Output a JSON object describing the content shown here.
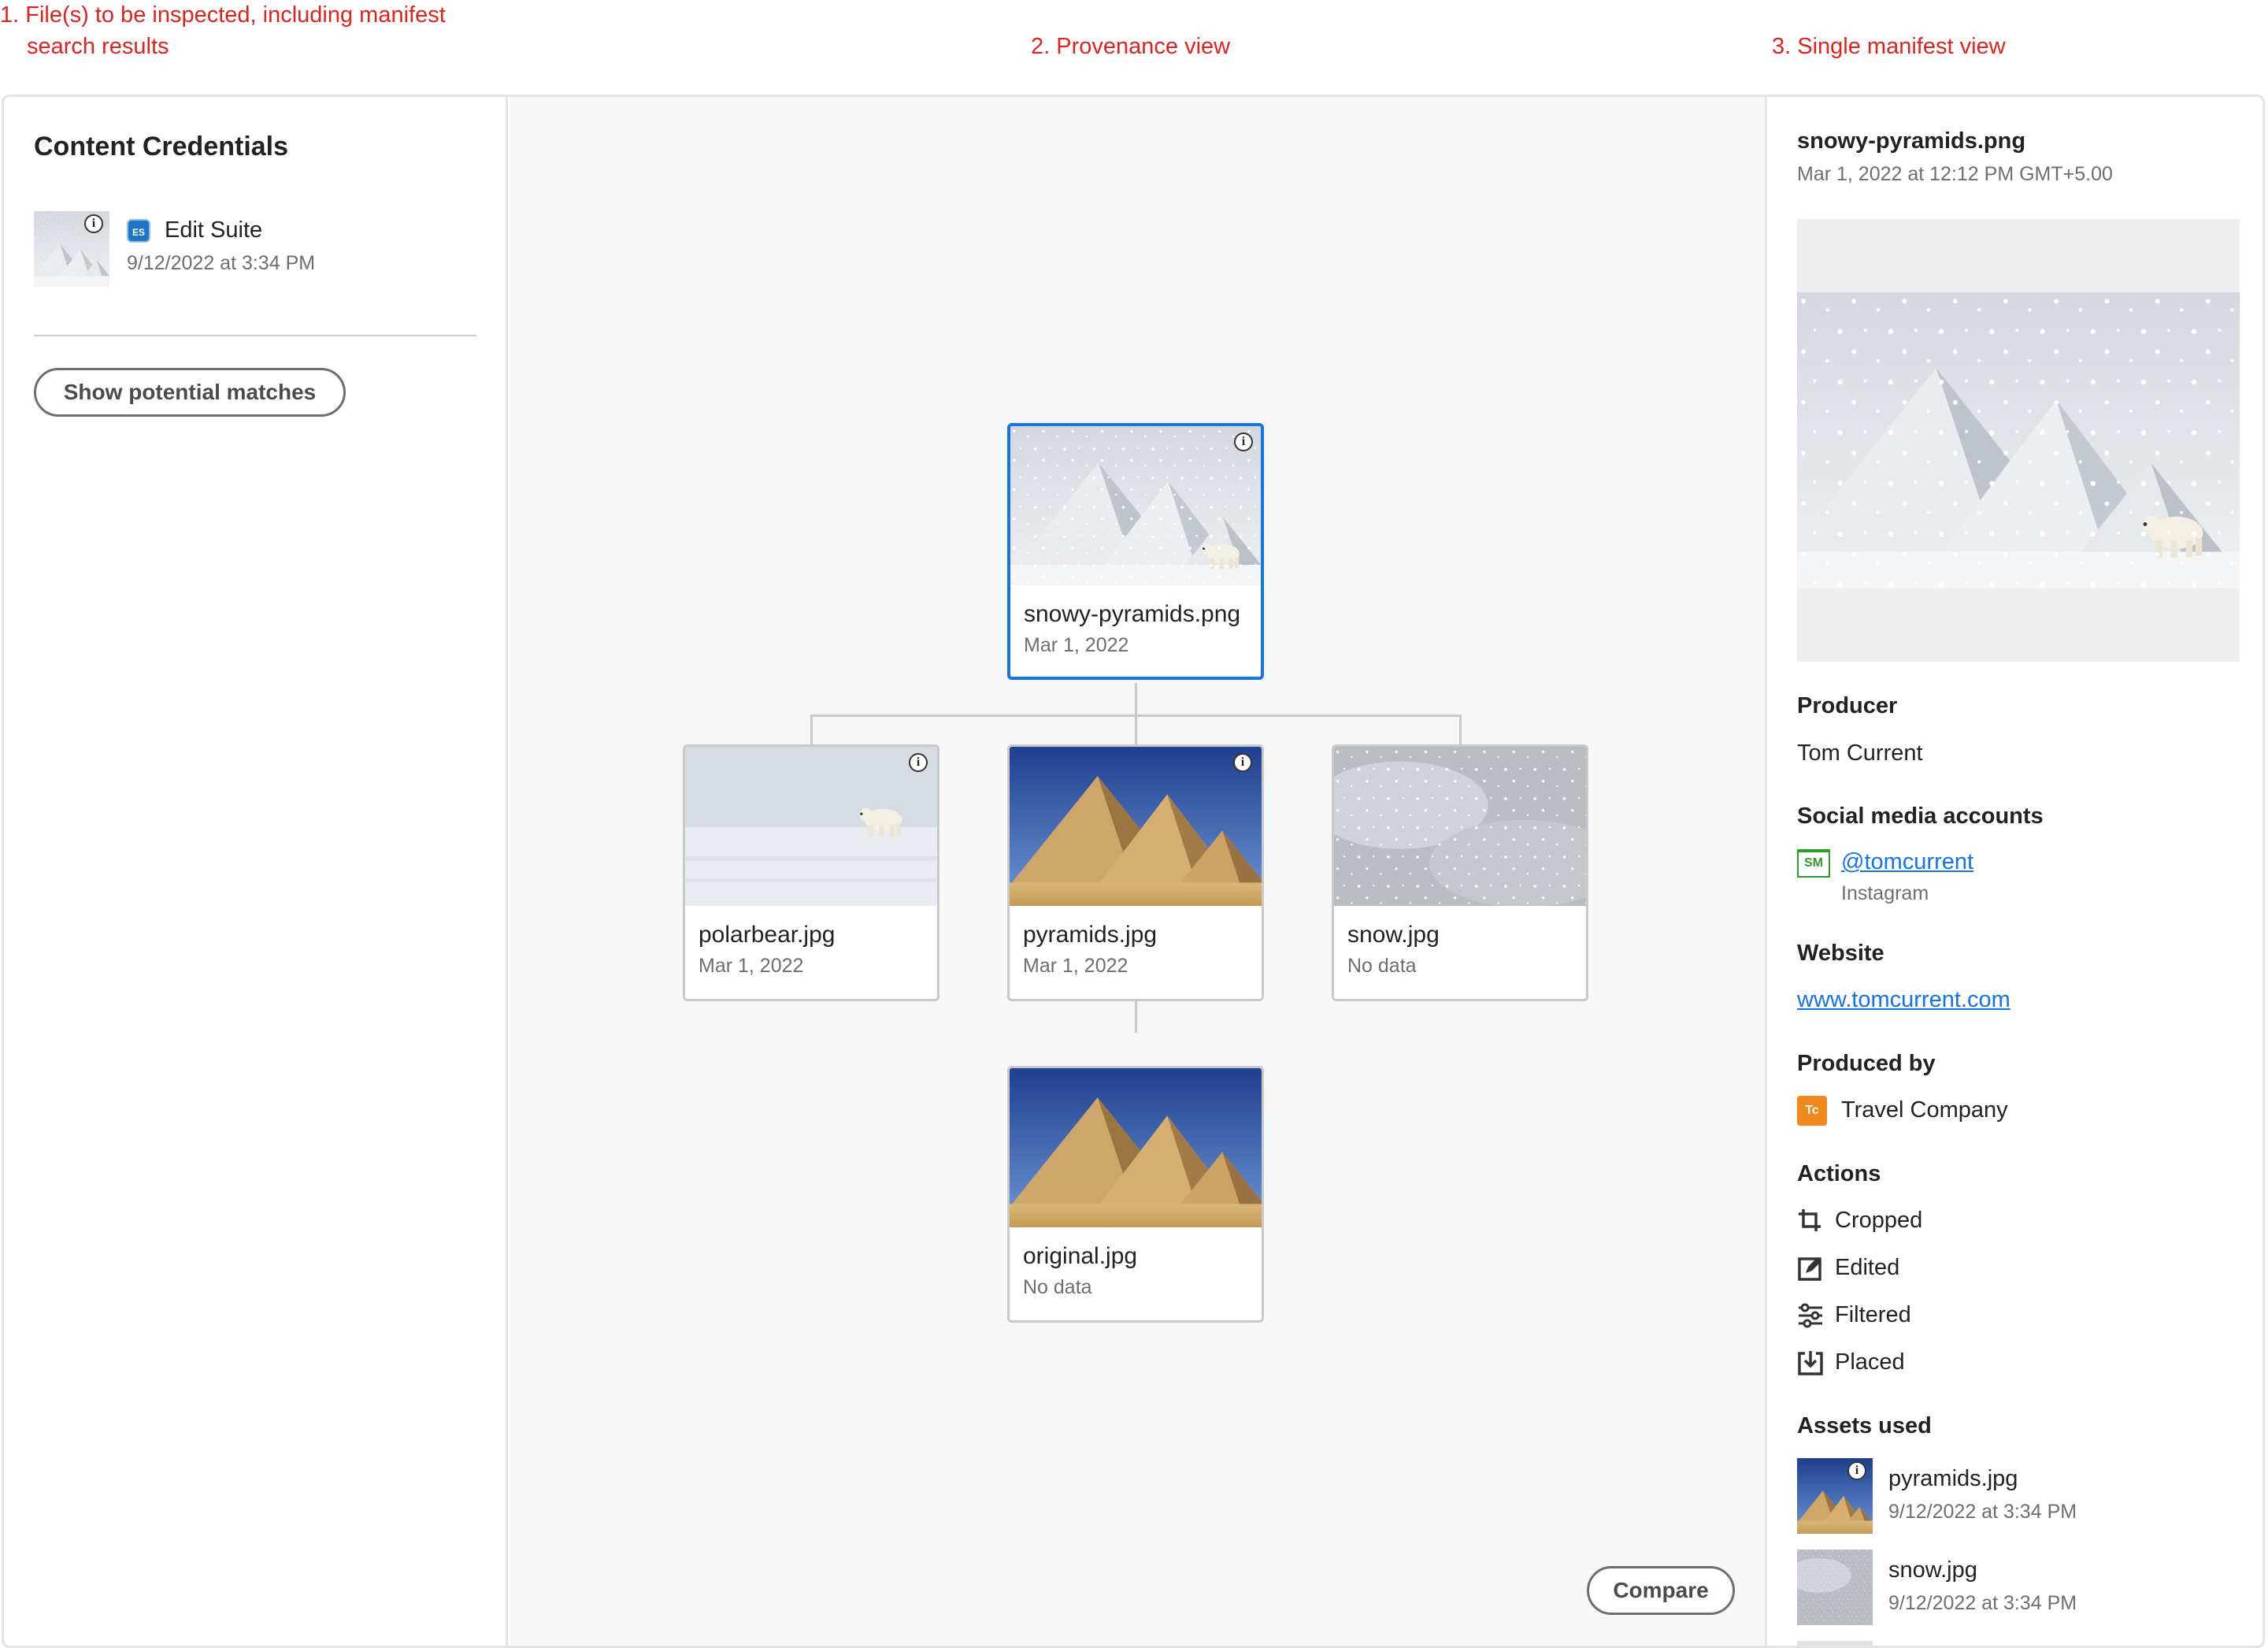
{
  "annotations": {
    "col1": "1. File(s) to be inspected, including manifest",
    "col1_line2": "search results",
    "col2": "2. Provenance view",
    "col3": "3. Single manifest view"
  },
  "left": {
    "title": "Content Credentials",
    "file": {
      "app_badge": "ES",
      "app": "Edit Suite",
      "date": "9/12/2022 at 3:34 PM"
    },
    "show_matches": "Show potential matches"
  },
  "tree": {
    "root": {
      "name": "snowy-pyramids.png",
      "date": "Mar 1, 2022"
    },
    "children": [
      {
        "name": "polarbear.jpg",
        "date": "Mar 1, 2022"
      },
      {
        "name": "pyramids.jpg",
        "date": "Mar 1, 2022"
      },
      {
        "name": "snow.jpg",
        "date": "No data"
      }
    ],
    "grandchild": {
      "name": "original.jpg",
      "date": "No data"
    },
    "compare": "Compare"
  },
  "manifest": {
    "title": "snowy-pyramids.png",
    "date": "Mar 1, 2022 at 12:12 PM GMT+5.00",
    "producer_label": "Producer",
    "producer": "Tom Current",
    "social_label": "Social media accounts",
    "social_badge": "SM",
    "social_handle": "@tomcurrent",
    "social_platform": "Instagram",
    "website_label": "Website",
    "website": "www.tomcurrent.com",
    "produced_by_label": "Produced by",
    "produced_by_badge": "Tc",
    "produced_by": "Travel Company",
    "actions_label": "Actions",
    "actions": [
      "Cropped",
      "Edited",
      "Filtered",
      "Placed"
    ],
    "assets_label": "Assets used",
    "assets": [
      {
        "name": "pyramids.jpg",
        "date": "9/12/2022 at 3:34 PM"
      },
      {
        "name": "snow.jpg",
        "date": "9/12/2022 at 3:34 PM"
      }
    ]
  },
  "colors": {
    "accent": "#1473e6",
    "annotation": "#e1231e"
  }
}
